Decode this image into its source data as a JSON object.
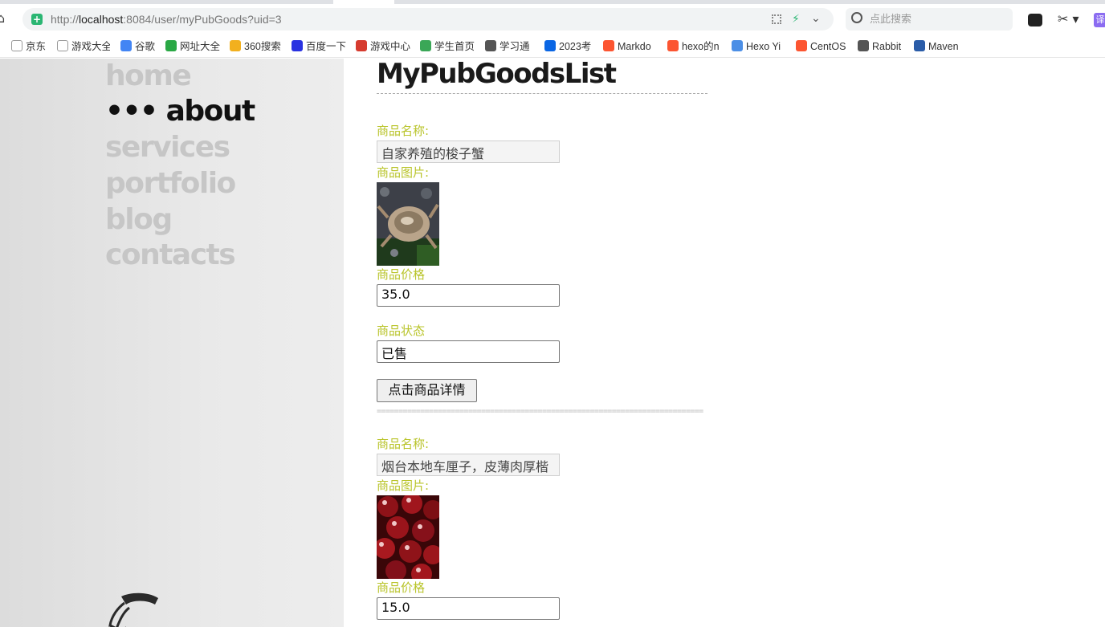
{
  "browser": {
    "url_prefix": "http://",
    "url_host": "localhost",
    "url_rest": ":8084/user/myPubGoods?uid=3",
    "search_placeholder": "点此搜索",
    "translate_label": "译"
  },
  "bookmarks": [
    {
      "label": "京东",
      "icon": "page-icon",
      "color": "#999999"
    },
    {
      "label": "游戏大全",
      "icon": "page-icon",
      "color": "#999999"
    },
    {
      "label": "谷歌",
      "icon": "google-icon",
      "color": "#4285f4"
    },
    {
      "label": "网址大全",
      "icon": "web-directory-icon",
      "color": "#2aa845"
    },
    {
      "label": "360搜索",
      "icon": "so360-icon",
      "color": "#f2b01e"
    },
    {
      "label": "百度一下",
      "icon": "baidu-paw-icon",
      "color": "#2932e1"
    },
    {
      "label": "游戏中心",
      "icon": "game-center-icon",
      "color": "#d63b2f"
    },
    {
      "label": "学生首页",
      "icon": "chart-icon",
      "color": "#3aa757"
    },
    {
      "label": "学习通",
      "icon": "globe-icon",
      "color": "#555555"
    },
    {
      "label": "2023考",
      "icon": "zhihu-icon",
      "color": "#0a66e4"
    },
    {
      "label": "Markdo",
      "icon": "csdn-icon",
      "color": "#fc5531"
    },
    {
      "label": "hexo的n",
      "icon": "csdn-icon",
      "color": "#fc5531"
    },
    {
      "label": "Hexo Yi",
      "icon": "blue-circle-icon",
      "color": "#4c8fe6"
    },
    {
      "label": "CentOS",
      "icon": "csdn-icon",
      "color": "#fc5531"
    },
    {
      "label": "Rabbit",
      "icon": "rabbit-icon",
      "color": "#555555"
    },
    {
      "label": "Maven",
      "icon": "mvn-icon",
      "color": "#2a5ca8"
    }
  ],
  "nav": [
    {
      "label": "home",
      "active": false
    },
    {
      "label": "••• about",
      "active": true
    },
    {
      "label": "services",
      "active": false
    },
    {
      "label": "portfolio",
      "active": false
    },
    {
      "label": "blog",
      "active": false
    },
    {
      "label": "contacts",
      "active": false
    }
  ],
  "page": {
    "title": "MyPubGoodsList",
    "separator": "==========================================================================="
  },
  "labels": {
    "name": "商品名称:",
    "image": "商品图片:",
    "price": "商品价格",
    "status": "商品状态",
    "detail_button": "点击商品详情"
  },
  "goods": [
    {
      "name": "自家养殖的梭子蟹",
      "price": "35.0",
      "status": "已售",
      "image": "crab-photo"
    },
    {
      "name": "烟台本地车厘子，皮薄肉厚楷",
      "price": "15.0",
      "image": "cherry-photo"
    }
  ],
  "colors": {
    "label_accent": "#b9c42a",
    "nav_inactive": "#c6c6c6",
    "nav_active": "#111111"
  }
}
